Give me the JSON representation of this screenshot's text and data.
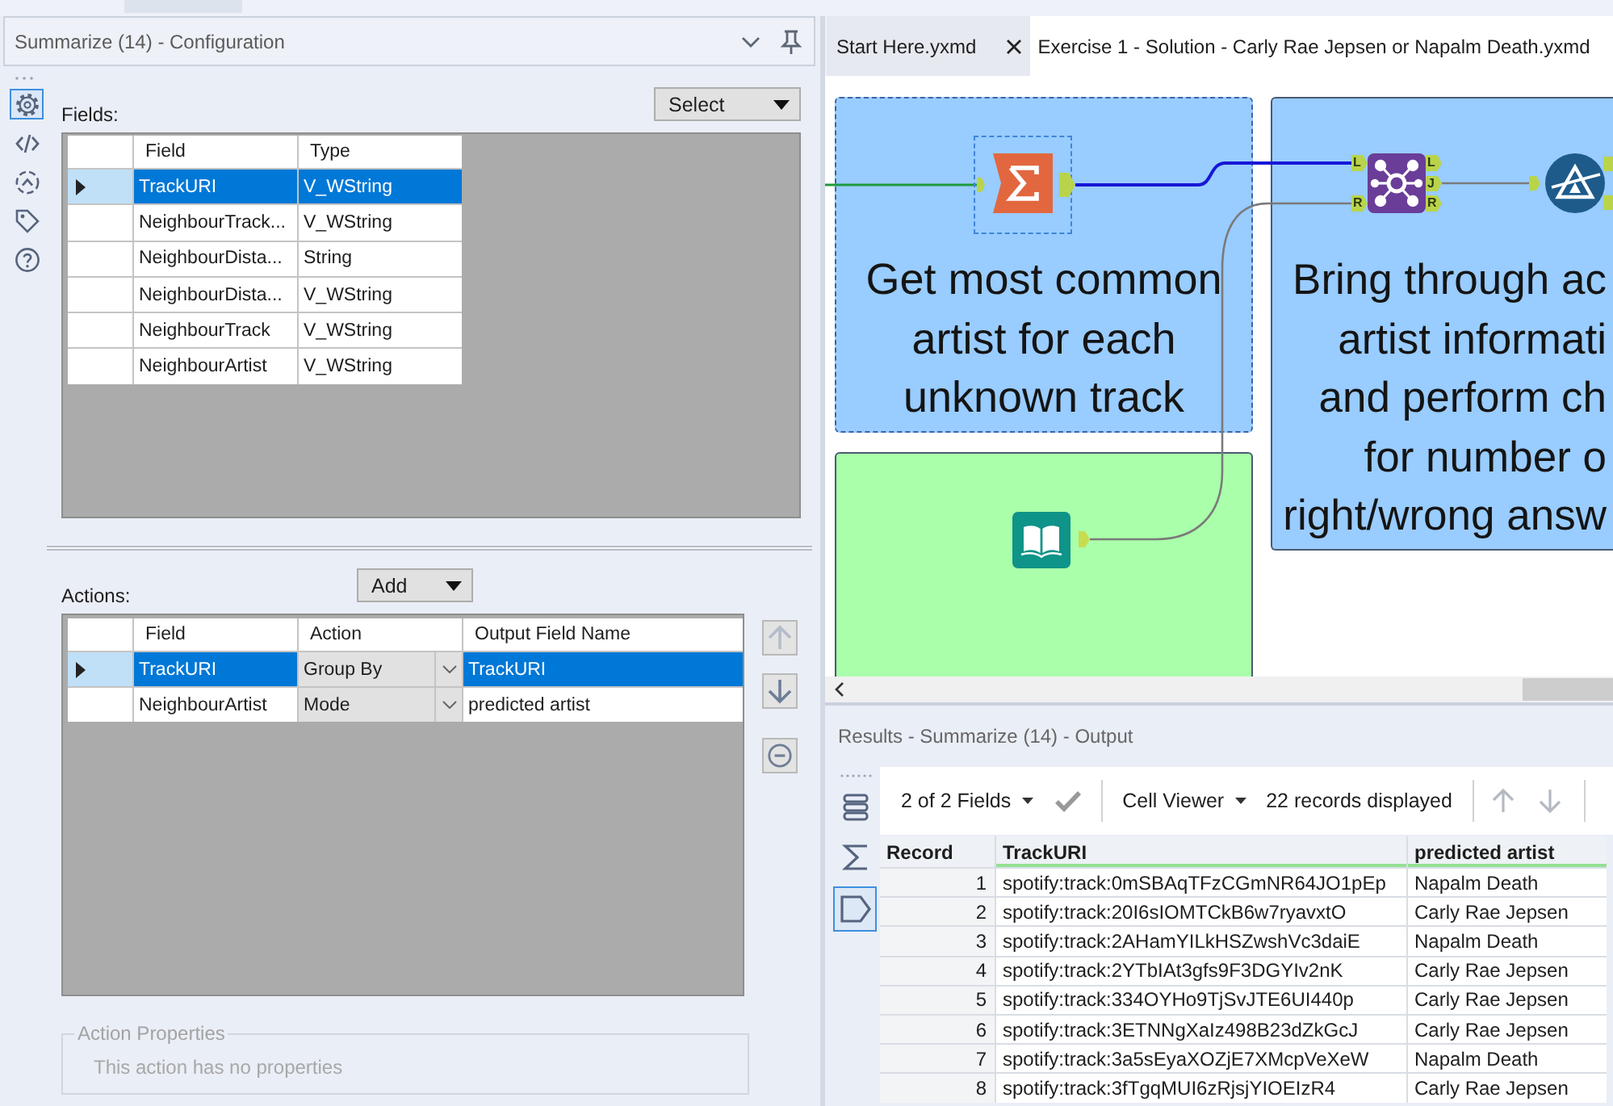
{
  "config_panel": {
    "title": "Summarize (14) - Configuration",
    "side_tools": [
      {
        "kind": "settings",
        "selected": true
      },
      {
        "kind": "code",
        "selected": false
      },
      {
        "kind": "connections",
        "selected": false
      },
      {
        "kind": "tag",
        "selected": false
      },
      {
        "kind": "help",
        "selected": false
      }
    ],
    "fields_label": "Fields:",
    "select_button": "Select",
    "fields_table": {
      "columns": [
        "Field",
        "Type"
      ],
      "rows": [
        {
          "field": "TrackURI",
          "type": "V_WString",
          "selected": true
        },
        {
          "field": "NeighbourTrack...",
          "type": "V_WString",
          "selected": false
        },
        {
          "field": "NeighbourDista...",
          "type": "String",
          "selected": false
        },
        {
          "field": "NeighbourDista...",
          "type": "V_WString",
          "selected": false
        },
        {
          "field": "NeighbourTrack",
          "type": "V_WString",
          "selected": false
        },
        {
          "field": "NeighbourArtist",
          "type": "V_WString",
          "selected": false
        }
      ]
    },
    "actions_label": "Actions:",
    "add_button": "Add",
    "actions_table": {
      "columns": [
        "Field",
        "Action",
        "Output Field Name"
      ],
      "rows": [
        {
          "field": "TrackURI",
          "action": "Group By",
          "output_field_name": "TrackURI",
          "selected": true
        },
        {
          "field": "NeighbourArtist",
          "action": "Mode",
          "output_field_name": "predicted artist",
          "selected": false
        }
      ]
    },
    "row_buttons": [
      {
        "kind": "move_up",
        "disabled": true
      },
      {
        "kind": "move_down",
        "disabled": false
      },
      {
        "kind": "remove",
        "disabled": false
      }
    ],
    "action_properties": {
      "legend": "Action Properties",
      "message": "This action has no properties"
    }
  },
  "workflow": {
    "tabs": [
      {
        "label": "Start Here.yxmd",
        "selected": false,
        "closable": true
      },
      {
        "label": "Exercise 1 - Solution - Carly Rae Jepsen or Napalm Death.yxmd",
        "selected": true,
        "closable": false
      }
    ],
    "containers": [
      {
        "color": "#99ccff",
        "selected": true,
        "caption_lines": [
          "Get most common",
          "artist for each",
          "unknown track"
        ]
      },
      {
        "color": "#99ccff",
        "selected": false,
        "caption_lines": [
          "Bring through ac",
          "artist informati",
          "and perform ch",
          "for number o",
          "right/wrong answ"
        ]
      },
      {
        "color": "#aaffaa",
        "selected": false
      }
    ],
    "tools": [
      {
        "kind": "summarize",
        "selected": true
      },
      {
        "kind": "join",
        "selected": false,
        "input_anchors": [
          "L",
          "R"
        ],
        "output_anchors": [
          "L",
          "J",
          "R"
        ]
      },
      {
        "kind": "filter",
        "selected": false
      },
      {
        "kind": "text_input",
        "selected": false
      }
    ]
  },
  "results": {
    "title": "Results - Summarize (14) - Output",
    "side_tools": [
      {
        "kind": "list",
        "selected": false
      },
      {
        "kind": "sigma",
        "selected": false
      },
      {
        "kind": "pentagon",
        "selected": true
      }
    ],
    "fields_dropdown": "2 of 2 Fields",
    "apply_button": {
      "disabled": true
    },
    "viewer_dropdown": "Cell Viewer",
    "record_count": "22 records displayed",
    "nav_buttons": [
      {
        "kind": "up",
        "disabled": true
      },
      {
        "kind": "down",
        "disabled": true
      }
    ],
    "table": {
      "columns": [
        "Record",
        "TrackURI",
        "predicted artist"
      ],
      "rows": [
        {
          "record": "1",
          "track_uri": "spotify:track:0mSBAqTFzCGmNR64JO1pEp",
          "predicted_artist": "Napalm Death"
        },
        {
          "record": "2",
          "track_uri": "spotify:track:20I6sIOMTCkB6w7ryavxtO",
          "predicted_artist": "Carly Rae Jepsen"
        },
        {
          "record": "3",
          "track_uri": "spotify:track:2AHamYILkHSZwshVc3daiE",
          "predicted_artist": "Napalm Death"
        },
        {
          "record": "4",
          "track_uri": "spotify:track:2YTbIAt3gfs9F3DGYIv2nK",
          "predicted_artist": "Carly Rae Jepsen"
        },
        {
          "record": "5",
          "track_uri": "spotify:track:334OYHo9TjSvJTE6UI440p",
          "predicted_artist": "Carly Rae Jepsen"
        },
        {
          "record": "6",
          "track_uri": "spotify:track:3ETNNgXaIz498B23dZkGcJ",
          "predicted_artist": "Carly Rae Jepsen"
        },
        {
          "record": "7",
          "track_uri": "spotify:track:3a5sEyaXOZjE7XMcpVeXeW",
          "predicted_artist": "Napalm Death"
        },
        {
          "record": "8",
          "track_uri": "spotify:track:3fTgqMUI6zRjsjYIOEIzR4",
          "predicted_artist": "Carly Rae Jepsen"
        }
      ]
    }
  }
}
